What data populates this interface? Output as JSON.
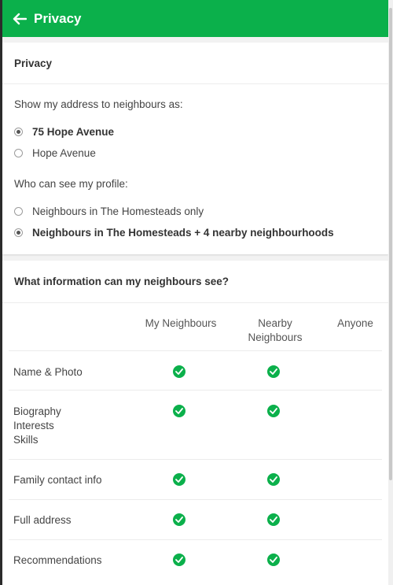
{
  "header": {
    "title": "Privacy"
  },
  "privacy_card": {
    "heading": "Privacy",
    "address_question": "Show my address to neighbours as:",
    "address_options": [
      {
        "label": "75 Hope Avenue",
        "selected": true
      },
      {
        "label": "Hope Avenue",
        "selected": false
      }
    ],
    "profile_question": "Who can see my profile:",
    "profile_options": [
      {
        "label": "Neighbours in The Homesteads only",
        "selected": false
      },
      {
        "label": "Neighbours in The Homesteads + 4 nearby neighbourhoods",
        "selected": true
      }
    ]
  },
  "visibility_card": {
    "heading": "What information can my neighbours see?",
    "columns": {
      "my_neighbours": "My Neighbours",
      "nearby_line1": "Nearby",
      "nearby_line2": "Neighbours",
      "anyone": "Anyone"
    },
    "rows": [
      {
        "lines": [
          "Name & Photo"
        ],
        "my_neighbours": true,
        "nearby": true,
        "anyone": false
      },
      {
        "lines": [
          "Biography",
          "Interests",
          "Skills"
        ],
        "my_neighbours": true,
        "nearby": true,
        "anyone": false
      },
      {
        "lines": [
          "Family contact info"
        ],
        "my_neighbours": true,
        "nearby": true,
        "anyone": false
      },
      {
        "lines": [
          "Full address"
        ],
        "my_neighbours": true,
        "nearby": true,
        "anyone": false
      },
      {
        "lines": [
          "Recommendations"
        ],
        "my_neighbours": true,
        "nearby": true,
        "anyone": false
      }
    ]
  },
  "colors": {
    "accent": "#0bb04b",
    "background": "#f2f2f2",
    "card": "#ffffff"
  }
}
